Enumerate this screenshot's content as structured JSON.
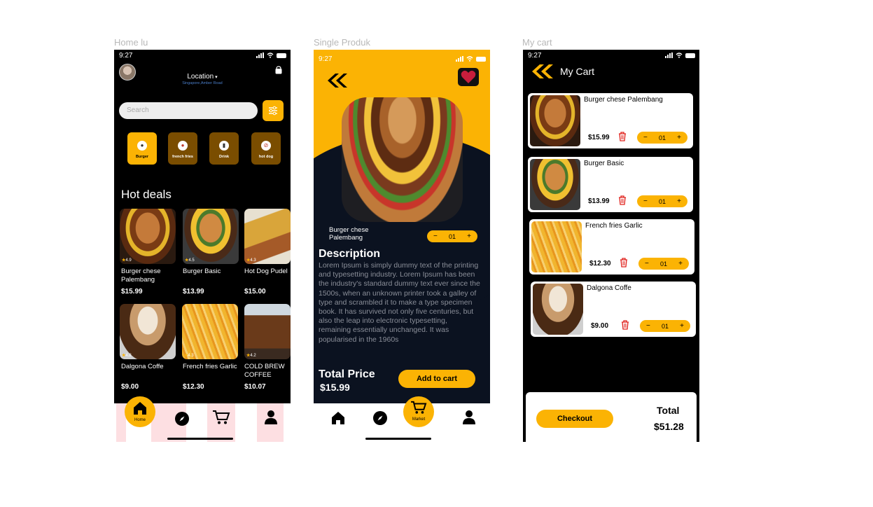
{
  "frames": {
    "home_label": "Home lu",
    "product_label": "Single Produk",
    "cart_label": "My cart"
  },
  "status_time": "9:27",
  "home": {
    "location_title": "Location",
    "location_sub": "Singapore,Amber Road",
    "search_placeholder": "Search",
    "categories": [
      {
        "label": "Burger",
        "icon": "burger-icon"
      },
      {
        "label": "french fries",
        "icon": "fries-icon"
      },
      {
        "label": "Drink",
        "icon": "drink-icon"
      },
      {
        "label": "hot dog",
        "icon": "hotdog-icon"
      }
    ],
    "section_title": "Hot deals",
    "deals": [
      {
        "name": "Burger chese Palembang",
        "price": "$15.99",
        "rating": "4.9"
      },
      {
        "name": "Burger Basic",
        "price": "$13.99",
        "rating": "4.5"
      },
      {
        "name": "Hot Dog Pudel",
        "price": "$15.00",
        "rating": "4.3"
      },
      {
        "name": "Dalgona Coffe",
        "price": "$9.00",
        "rating": "4.8"
      },
      {
        "name": "French fries Garlic",
        "price": "$12.30",
        "rating": "4.3"
      },
      {
        "name": "COLD BREW COFFEE",
        "price": "$10.07",
        "rating": "4.2"
      }
    ],
    "nav_home_label": "Home"
  },
  "product": {
    "name": "Burger chese Palembang",
    "qty": "01",
    "description_title": "Description",
    "description": "Lorem Ipsum is simply dummy text of the printing and typesetting industry. Lorem Ipsum has been the industry's standard dummy text ever since the 1500s, when an unknown printer took a galley of type and scrambled it to make a type specimen book. It has survived not only five centuries, but also the leap into electronic typesetting, remaining essentially unchanged. It was popularised in the 1960s",
    "total_label": "Total Price",
    "total_value": "$15.99",
    "add_to_cart": "Add to cart",
    "nav_market_label": "Market"
  },
  "cart": {
    "title": "My Cart",
    "items": [
      {
        "name": "Burger chese Palembang",
        "price": "$15.99",
        "qty": "01"
      },
      {
        "name": "Burger Basic",
        "price": "$13.99",
        "qty": "01"
      },
      {
        "name": "French fries Garlic",
        "price": "$12.30",
        "qty": "01"
      },
      {
        "name": "Dalgona Coffe",
        "price": "$9.00",
        "qty": "01"
      }
    ],
    "checkout": "Checkout",
    "total_label": "Total",
    "total_value": "$51.28"
  },
  "colors": {
    "accent": "#fbb304",
    "dark": "#000000",
    "navy": "#0b1220",
    "trash": "#e0201b"
  }
}
